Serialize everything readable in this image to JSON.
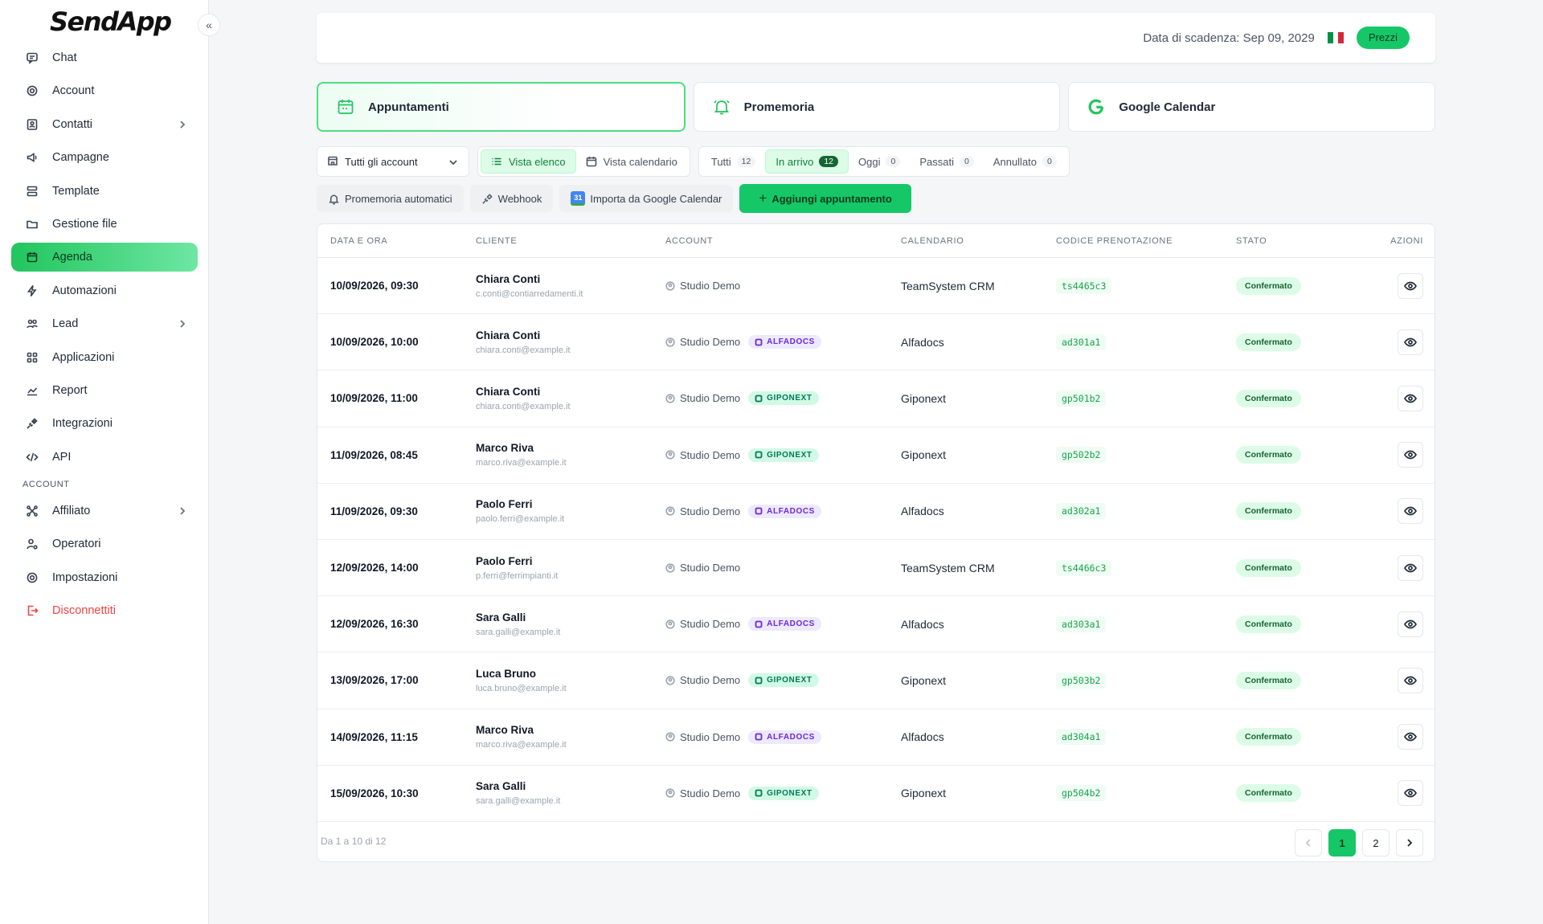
{
  "brand": "SendApp",
  "sidebar": {
    "items": [
      {
        "label": "Chat",
        "icon": "chat-icon"
      },
      {
        "label": "Account",
        "icon": "gear-icon"
      },
      {
        "label": "Contatti",
        "icon": "contacts-icon",
        "has_children": true
      },
      {
        "label": "Campagne",
        "icon": "megaphone-icon"
      },
      {
        "label": "Template",
        "icon": "template-icon"
      },
      {
        "label": "Gestione file",
        "icon": "folder-icon"
      },
      {
        "label": "Agenda",
        "icon": "calendar-icon",
        "active": true
      },
      {
        "label": "Automazioni",
        "icon": "bolt-icon"
      },
      {
        "label": "Lead",
        "icon": "users-icon",
        "has_children": true
      },
      {
        "label": "Applicazioni",
        "icon": "apps-icon"
      },
      {
        "label": "Report",
        "icon": "chart-icon"
      },
      {
        "label": "Integrazioni",
        "icon": "plug-icon"
      },
      {
        "label": "API",
        "icon": "code-icon"
      }
    ],
    "section_label": "ACCOUNT",
    "account_items": [
      {
        "label": "Affiliato",
        "icon": "share-icon",
        "has_children": true
      },
      {
        "label": "Operatori",
        "icon": "user-gear-icon"
      },
      {
        "label": "Impostazioni",
        "icon": "gear-icon"
      },
      {
        "label": "Disconnettiti",
        "icon": "logout-icon",
        "danger": true
      }
    ]
  },
  "topbar": {
    "expiry": "Data di scadenza: Sep 09, 2029",
    "price_label": "Prezzi",
    "flag_colors": [
      "#009246",
      "#ffffff",
      "#ce2b37"
    ]
  },
  "tabs": [
    {
      "label": "Appuntamenti",
      "icon": "calendar-icon",
      "active": true
    },
    {
      "label": "Promemoria",
      "icon": "bell-icon"
    },
    {
      "label": "Google Calendar",
      "icon": "google-icon"
    }
  ],
  "filters": {
    "account_select": "Tutti gli account",
    "views": [
      {
        "label": "Vista elenco",
        "active": true
      },
      {
        "label": "Vista calendario"
      }
    ],
    "statuses": [
      {
        "label": "Tutti",
        "count": "12"
      },
      {
        "label": "In arrivo",
        "count": "12",
        "active": true
      },
      {
        "label": "Oggi",
        "count": "0"
      },
      {
        "label": "Passati",
        "count": "0"
      },
      {
        "label": "Annullato",
        "count": "0"
      }
    ]
  },
  "actions": {
    "auto_reminders": "Promemoria automatici",
    "webhook": "Webhook",
    "import_gcal": "Importa da Google Calendar",
    "gcal_badge": "31",
    "add": "Aggiungi appuntamento"
  },
  "table": {
    "headers": [
      "DATA E ORA",
      "CLIENTE",
      "ACCOUNT",
      "CALENDARIO",
      "CODICE PRENOTAZIONE",
      "STATO",
      "AZIONI"
    ],
    "rows": [
      {
        "datetime": "10/09/2026, 09:30",
        "name": "Chiara Conti",
        "email": "c.conti@contiarredamenti.it",
        "account": "Studio Demo",
        "tag": "",
        "calendar": "TeamSystem CRM",
        "code": "ts4465c3",
        "status": "Confermato"
      },
      {
        "datetime": "10/09/2026, 10:00",
        "name": "Chiara Conti",
        "email": "chiara.conti@example.it",
        "account": "Studio Demo",
        "tag": "ALFADOCS",
        "calendar": "Alfadocs",
        "code": "ad301a1",
        "status": "Confermato"
      },
      {
        "datetime": "10/09/2026, 11:00",
        "name": "Chiara Conti",
        "email": "chiara.conti@example.it",
        "account": "Studio Demo",
        "tag": "GIPONEXT",
        "calendar": "Giponext",
        "code": "gp501b2",
        "status": "Confermato"
      },
      {
        "datetime": "11/09/2026, 08:45",
        "name": "Marco Riva",
        "email": "marco.riva@example.it",
        "account": "Studio Demo",
        "tag": "GIPONEXT",
        "calendar": "Giponext",
        "code": "gp502b2",
        "status": "Confermato"
      },
      {
        "datetime": "11/09/2026, 09:30",
        "name": "Paolo Ferri",
        "email": "paolo.ferri@example.it",
        "account": "Studio Demo",
        "tag": "ALFADOCS",
        "calendar": "Alfadocs",
        "code": "ad302a1",
        "status": "Confermato"
      },
      {
        "datetime": "12/09/2026, 14:00",
        "name": "Paolo Ferri",
        "email": "p.ferri@ferrimpianti.it",
        "account": "Studio Demo",
        "tag": "",
        "calendar": "TeamSystem CRM",
        "code": "ts4466c3",
        "status": "Confermato"
      },
      {
        "datetime": "12/09/2026, 16:30",
        "name": "Sara Galli",
        "email": "sara.galli@example.it",
        "account": "Studio Demo",
        "tag": "ALFADOCS",
        "calendar": "Alfadocs",
        "code": "ad303a1",
        "status": "Confermato"
      },
      {
        "datetime": "13/09/2026, 17:00",
        "name": "Luca Bruno",
        "email": "luca.bruno@example.it",
        "account": "Studio Demo",
        "tag": "GIPONEXT",
        "calendar": "Giponext",
        "code": "gp503b2",
        "status": "Confermato"
      },
      {
        "datetime": "14/09/2026, 11:15",
        "name": "Marco Riva",
        "email": "marco.riva@example.it",
        "account": "Studio Demo",
        "tag": "ALFADOCS",
        "calendar": "Alfadocs",
        "code": "ad304a1",
        "status": "Confermato"
      },
      {
        "datetime": "15/09/2026, 10:30",
        "name": "Sara Galli",
        "email": "sara.galli@example.it",
        "account": "Studio Demo",
        "tag": "GIPONEXT",
        "calendar": "Giponext",
        "code": "gp504b2",
        "status": "Confermato"
      }
    ],
    "range_text": "Da 1 a 10 di 12",
    "pages": [
      "1",
      "2"
    ],
    "current_page": "1"
  },
  "colors": {
    "accent": "#16c768",
    "danger": "#ef4444"
  }
}
